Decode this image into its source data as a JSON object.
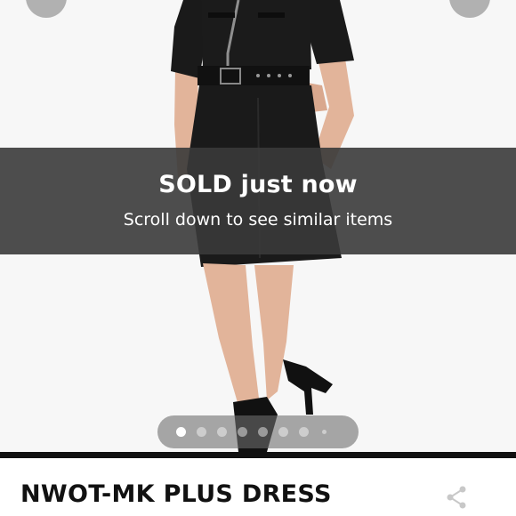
{
  "listing": {
    "title": "NWOT-MK PLUS DRESS",
    "photo_count": 8,
    "active_photo_index": 1
  },
  "banner": {
    "status": "SOLD just now",
    "message": "Scroll down to see similar items"
  },
  "icons": {
    "prev": "chevron-left-icon",
    "next": "chevron-right-icon",
    "share": "share-icon"
  },
  "colors": {
    "banner_bg": "#3a3a3a",
    "dress": "#1a1a1a",
    "divider": "#111111"
  }
}
